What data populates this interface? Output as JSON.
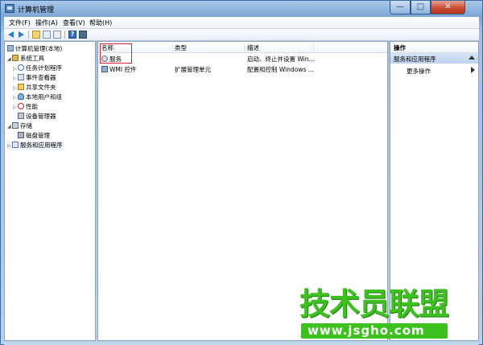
{
  "window": {
    "title": "计算机管理"
  },
  "titlebar_buttons": {
    "minimize": "—",
    "maximize": "□",
    "close": "✕"
  },
  "menu": [
    "文件(F)",
    "操作(A)",
    "查看(V)",
    "帮助(H)"
  ],
  "toolbar": {
    "help": "?"
  },
  "tree": {
    "root": "计算机管理(本地)",
    "items": [
      {
        "label": "系统工具",
        "icon": "tools-icon"
      },
      {
        "label": "任务计划程序",
        "icon": "clock-icon"
      },
      {
        "label": "事件查看器",
        "icon": "event-log-icon"
      },
      {
        "label": "共享文件夹",
        "icon": "shared-folder-icon"
      },
      {
        "label": "本地用户和组",
        "icon": "users-icon"
      },
      {
        "label": "性能",
        "icon": "performance-icon"
      },
      {
        "label": "设备管理器",
        "icon": "device-manager-icon"
      },
      {
        "label": "存储",
        "icon": "storage-icon"
      },
      {
        "label": "磁盘管理",
        "icon": "disk-icon"
      },
      {
        "label": "服务和应用程序",
        "icon": "services-apps-icon"
      }
    ]
  },
  "list": {
    "columns": [
      "名称",
      "类型",
      "描述"
    ],
    "rows": [
      {
        "name": "服务",
        "type": "",
        "description": "启动、终止并设置 Win...",
        "icon": "gear-icon"
      },
      {
        "name": "WMI 控件",
        "type": "扩展管理单元",
        "description": "配置和控制 Windows ...",
        "icon": "wmi-icon"
      }
    ]
  },
  "actions": {
    "header": "操作",
    "group": "服务和应用程序",
    "items": [
      "更多操作"
    ]
  },
  "watermark": {
    "main": "技术员联盟",
    "url": "www.jsgho.com"
  }
}
